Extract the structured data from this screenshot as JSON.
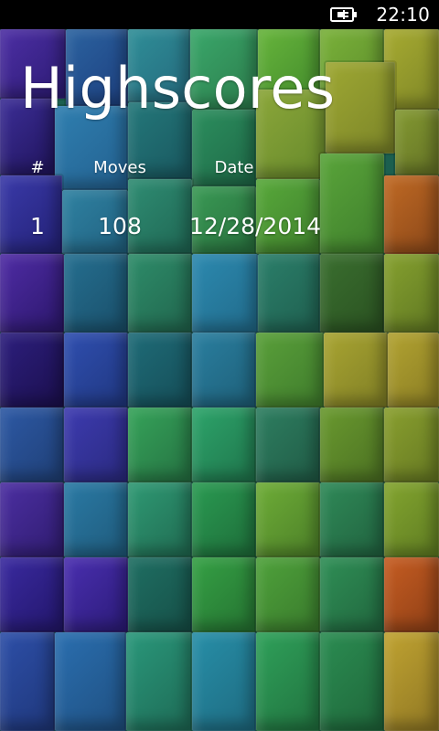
{
  "status_bar": {
    "battery_icon": "battery-charging-icon",
    "time": "22:10"
  },
  "page": {
    "title": "Highscores"
  },
  "table": {
    "headers": [
      "#",
      "Moves",
      "Date"
    ],
    "rows": [
      [
        "1",
        "108",
        "12/28/2014"
      ]
    ]
  },
  "colors": {
    "status_bar_bg": "#000000",
    "text": "#ffffff"
  }
}
